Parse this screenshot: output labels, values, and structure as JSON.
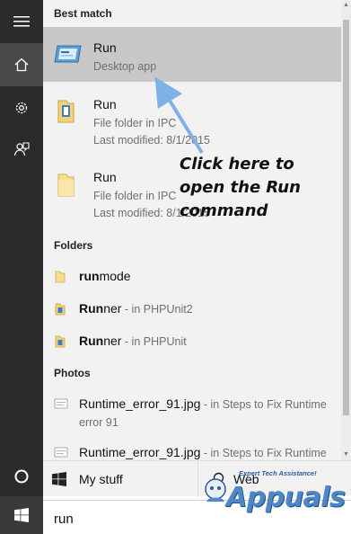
{
  "search": {
    "query": "run"
  },
  "best_match": {
    "heading": "Best match",
    "title": "Run",
    "subtitle": "Desktop app"
  },
  "results": [
    {
      "title": "Run",
      "line1": "File folder in IPC",
      "line2": "Last modified: 8/1/2015"
    },
    {
      "title": "Run",
      "line1": "File folder in IPC",
      "line2": "Last modified: 8/1/2015"
    }
  ],
  "folders": {
    "heading": "Folders",
    "items": [
      {
        "bold": "run",
        "rest": "mode",
        "loc": ""
      },
      {
        "bold": "Run",
        "rest": "ner",
        "loc": " - in PHPUnit2"
      },
      {
        "bold": "Run",
        "rest": "ner",
        "loc": " - in PHPUnit"
      }
    ]
  },
  "photos": {
    "heading": "Photos",
    "items": [
      {
        "bold": "Run",
        "rest": "time_error_91.jpg",
        "loc": " - in Steps to Fix Runtime",
        "loc2": "error 91"
      },
      {
        "bold": "Run",
        "rest": "time_error_91.jpg",
        "loc": " - in Steps to Fix Runtime"
      }
    ]
  },
  "tabs": {
    "mystuff": "My stuff",
    "web": "Web"
  },
  "annotation": {
    "line1": "Click here to",
    "line2": "open the Run",
    "line3": "command"
  },
  "watermark": {
    "tagline": "Expert Tech Assistance!",
    "name": "Appuals"
  },
  "colors": {
    "rail": "#2b2b2b",
    "panel": "#f2f2f2",
    "selected": "#c8c8c8",
    "arrow": "#7fb0e6",
    "brand": "#4f86c6"
  },
  "icons": {
    "rail": [
      "hamburger-menu-icon",
      "home-icon",
      "settings-gear-icon",
      "feedback-icon",
      "cortana-icon",
      "windows-start-icon"
    ],
    "best_match": "run-app-icon",
    "results": "folder-icon",
    "photos": "image-file-icon"
  }
}
